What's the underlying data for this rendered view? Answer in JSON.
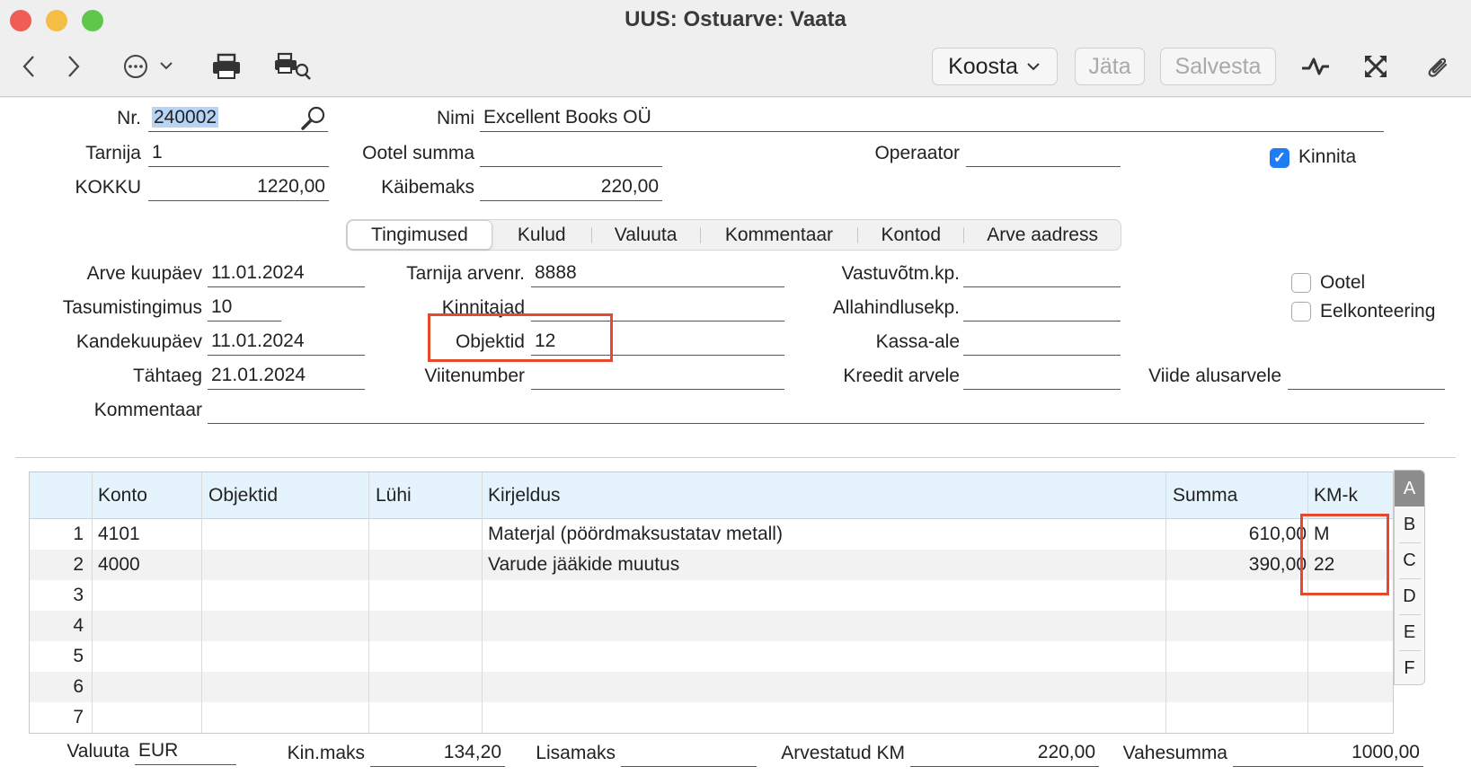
{
  "window": {
    "title": "UUS: Ostuarve: Vaata",
    "traffic_colors": [
      "#ee5e55",
      "#f4bd43",
      "#5fc84a"
    ]
  },
  "toolbar": {
    "koosta_label": "Koosta",
    "jata_label": "Jäta",
    "salvesta_label": "Salvesta"
  },
  "header": {
    "nr_label": "Nr.",
    "nr_value": "240002",
    "nimi_label": "Nimi",
    "nimi_value": "Excellent Books OÜ",
    "tarnija_label": "Tarnija",
    "tarnija_value": "1",
    "ootel_summa_label": "Ootel summa",
    "ootel_summa_value": "",
    "operaator_label": "Operaator",
    "operaator_value": "",
    "kinnita_label": "Kinnita",
    "kinnita_checked": true,
    "kokku_label": "KOKKU",
    "kokku_value": "1220,00",
    "kaibemaks_label": "Käibemaks",
    "kaibemaks_value": "220,00"
  },
  "tabs": [
    {
      "label": "Tingimused",
      "active": true
    },
    {
      "label": "Kulud",
      "active": false
    },
    {
      "label": "Valuuta",
      "active": false
    },
    {
      "label": "Kommentaar",
      "active": false
    },
    {
      "label": "Kontod",
      "active": false
    },
    {
      "label": "Arve aadress",
      "active": false
    }
  ],
  "conditions": {
    "arve_kuupaev_label": "Arve kuupäev",
    "arve_kuupaev_value": "11.01.2024",
    "tarnija_arvenr_label": "Tarnija arvenr.",
    "tarnija_arvenr_value": "8888",
    "vastuvotm_label": "Vastuvõtm.kp.",
    "vastuvotm_value": "",
    "ootel_label": "Ootel",
    "tasumistingimus_label": "Tasumistingimus",
    "tasumistingimus_value": "10",
    "kinnitajad_label": "Kinnitajad",
    "kinnitajad_value": "",
    "allahindluse_label": "Allahindlusekp.",
    "allahindluse_value": "",
    "eelkonteering_label": "Eelkonteering",
    "kandekuupaev_label": "Kandekuupäev",
    "kandekuupaev_value": "11.01.2024",
    "objektid_label": "Objektid",
    "objektid_value": "12",
    "kassa_ale_label": "Kassa-ale",
    "kassa_ale_value": "",
    "tahtaeg_label": "Tähtaeg",
    "tahtaeg_value": "21.01.2024",
    "viitenumber_label": "Viitenumber",
    "viitenumber_value": "",
    "kreedit_label": "Kreedit arvele",
    "kreedit_value": "",
    "viide_label": "Viide alusarvele",
    "viide_value": "",
    "kommentaar_label": "Kommentaar",
    "kommentaar_value": ""
  },
  "grid": {
    "columns": [
      "Konto",
      "Objektid",
      "Lühi",
      "Kirjeldus",
      "Summa",
      "KM-k"
    ],
    "rows": [
      {
        "n": "1",
        "konto": "4101",
        "objektid": "",
        "luhi": "",
        "kirjeldus": "Materjal (pöördmaksustatav metall)",
        "summa": "610,00",
        "kmk": "M"
      },
      {
        "n": "2",
        "konto": "4000",
        "objektid": "",
        "luhi": "",
        "kirjeldus": "Varude jääkide muutus",
        "summa": "390,00",
        "kmk": "22"
      },
      {
        "n": "3",
        "konto": "",
        "objektid": "",
        "luhi": "",
        "kirjeldus": "",
        "summa": "",
        "kmk": ""
      },
      {
        "n": "4",
        "konto": "",
        "objektid": "",
        "luhi": "",
        "kirjeldus": "",
        "summa": "",
        "kmk": ""
      },
      {
        "n": "5",
        "konto": "",
        "objektid": "",
        "luhi": "",
        "kirjeldus": "",
        "summa": "",
        "kmk": ""
      },
      {
        "n": "6",
        "konto": "",
        "objektid": "",
        "luhi": "",
        "kirjeldus": "",
        "summa": "",
        "kmk": ""
      },
      {
        "n": "7",
        "konto": "",
        "objektid": "",
        "luhi": "",
        "kirjeldus": "",
        "summa": "",
        "kmk": ""
      }
    ],
    "side_tabs": [
      "A",
      "B",
      "C",
      "D",
      "E",
      "F"
    ]
  },
  "footer": {
    "valuuta_label": "Valuuta",
    "valuuta_value": "EUR",
    "kinmaks_label": "Kin.maks",
    "kinmaks_value": "134,20",
    "lisamaks_label": "Lisamaks",
    "lisamaks_value": "",
    "arvestatud_label": "Arvestatud KM",
    "arvestatud_value": "220,00",
    "vahesumma_label": "Vahesumma",
    "vahesumma_value": "1000,00"
  },
  "icons": [
    "back-icon",
    "forward-icon",
    "more-icon",
    "print-icon",
    "print-preview-icon",
    "activity-icon",
    "fullscreen-icon",
    "paperclip-icon",
    "search-icon"
  ],
  "colors": {
    "accent": "#1f7cf4",
    "highlight_box": "#e54a2d",
    "grid_header": "#e4f3fc"
  }
}
